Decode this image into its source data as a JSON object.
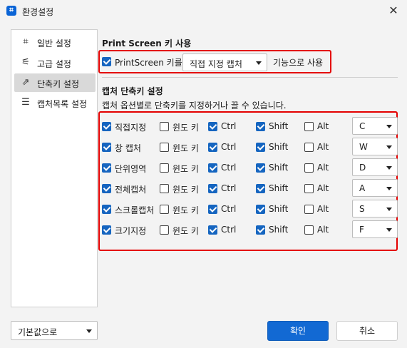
{
  "window": {
    "title": "환경설정",
    "icon": "crop-icon"
  },
  "sidebar": {
    "items": [
      {
        "label": "일반 설정",
        "icon": "crop-icon",
        "glyph": "⌗"
      },
      {
        "label": "고급 설정",
        "icon": "sliders-icon",
        "glyph": "⚟"
      },
      {
        "label": "단축키 설정",
        "icon": "arrow-box-icon",
        "glyph": "⇗"
      },
      {
        "label": "캡처목록 설정",
        "icon": "list-frame-icon",
        "glyph": "☰"
      }
    ],
    "active_index": 2
  },
  "printscreen": {
    "heading": "Print Screen 키 사용",
    "checkbox_label": "PrintScreen 키를",
    "checked": true,
    "selected_option": "직접 지정 캡처",
    "suffix": "기능으로 사용"
  },
  "shortcuts": {
    "heading": "캡처 단축키 설정",
    "description": "캡처 옵션별로 단축키를 지정하거나 끌 수 있습니다.",
    "modifier_labels": {
      "win": "윈도 키",
      "ctrl": "Ctrl",
      "shift": "Shift",
      "alt": "Alt"
    },
    "rows": [
      {
        "name": "직접지정",
        "enabled": true,
        "win": false,
        "ctrl": true,
        "shift": true,
        "alt": false,
        "key": "C"
      },
      {
        "name": "창 캡처",
        "enabled": true,
        "win": false,
        "ctrl": true,
        "shift": true,
        "alt": false,
        "key": "W"
      },
      {
        "name": "단위영역",
        "enabled": true,
        "win": false,
        "ctrl": true,
        "shift": true,
        "alt": false,
        "key": "D"
      },
      {
        "name": "전체캡처",
        "enabled": true,
        "win": false,
        "ctrl": true,
        "shift": true,
        "alt": false,
        "key": "A"
      },
      {
        "name": "스크롤캡처",
        "enabled": true,
        "win": false,
        "ctrl": true,
        "shift": true,
        "alt": false,
        "key": "S"
      },
      {
        "name": "크기지정",
        "enabled": true,
        "win": false,
        "ctrl": true,
        "shift": true,
        "alt": false,
        "key": "F"
      }
    ]
  },
  "footer": {
    "defaults_label": "기본값으로",
    "ok_label": "확인",
    "cancel_label": "취소"
  },
  "colors": {
    "accent": "#1269d3",
    "highlight_box": "#e40000"
  }
}
